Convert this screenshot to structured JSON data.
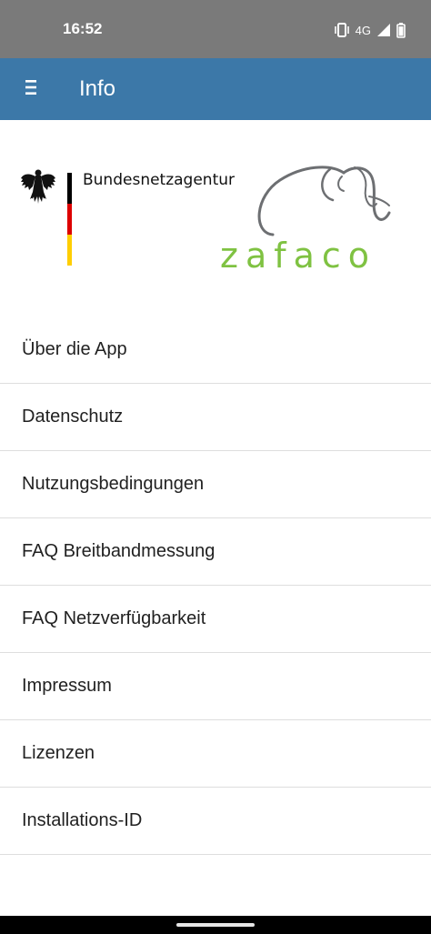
{
  "status_bar": {
    "time": "16:52",
    "network": "4G",
    "icons": [
      "vibrate-icon",
      "signal-icon",
      "battery-icon"
    ]
  },
  "app_bar": {
    "title": "Info",
    "menu_icon": "hamburger-menu-icon",
    "color": "#3c78a8"
  },
  "logos": {
    "bundesnetzagentur": "Bundesnetzagentur",
    "zafaco": "zafaco",
    "zafaco_color": "#7fc242",
    "flag_colors": [
      "#000000",
      "#dd0000",
      "#ffce00"
    ]
  },
  "menu_items": [
    {
      "label": "Über die App"
    },
    {
      "label": "Datenschutz"
    },
    {
      "label": "Nutzungsbedingungen"
    },
    {
      "label": "FAQ Breitbandmessung"
    },
    {
      "label": "FAQ Netzverfügbarkeit"
    },
    {
      "label": "Impressum"
    },
    {
      "label": "Lizenzen"
    },
    {
      "label": "Installations-ID"
    }
  ]
}
